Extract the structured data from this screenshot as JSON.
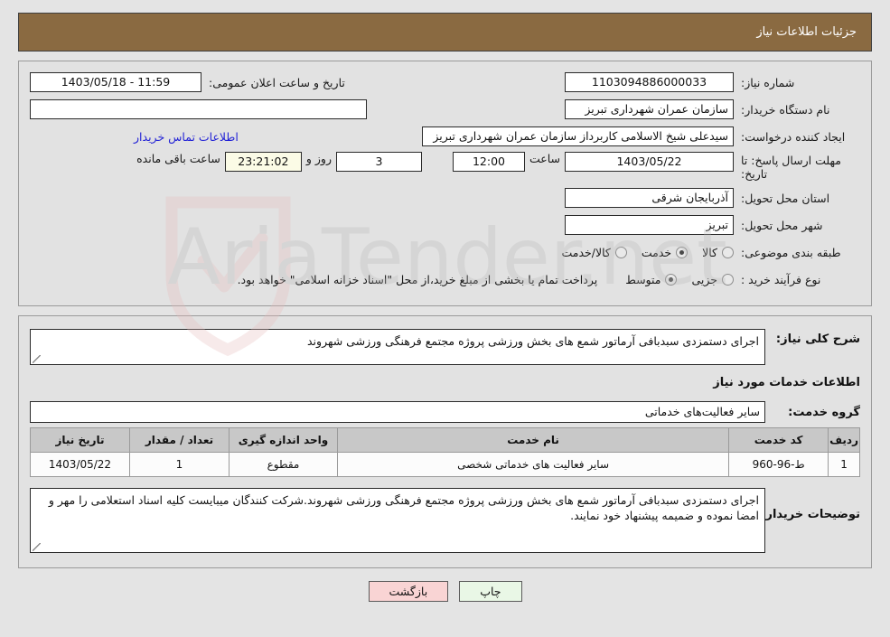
{
  "header": {
    "title": "جزئیات اطلاعات نیاز"
  },
  "form": {
    "need_number": {
      "label": "شماره نیاز:",
      "value": "1103094886000033"
    },
    "public_announce": {
      "label": "تاریخ و ساعت اعلان عمومی:",
      "value": "11:59 - 1403/05/18"
    },
    "buyer_org": {
      "label": "نام دستگاه خریدار:",
      "value": "سازمان عمران شهرداری تبریز"
    },
    "empty_field": {
      "label": "",
      "value": ""
    },
    "requester": {
      "label": "ایجاد کننده درخواست:",
      "value": "سیدعلی شیخ الاسلامی کاربرداز سازمان عمران شهرداری تبریز"
    },
    "buyer_contact_link": "اطلاعات تماس خریدار",
    "deadline": {
      "label": "مهلت ارسال پاسخ: تا تاریخ:",
      "date": "1403/05/22",
      "time_label": "ساعت",
      "time": "12:00",
      "days": "3",
      "days_label": "روز و",
      "countdown": "23:21:02",
      "countdown_label": "ساعت باقی مانده"
    },
    "province": {
      "label": "استان محل تحویل:",
      "value": "آذربایجان شرقی"
    },
    "city": {
      "label": "شهر محل تحویل:",
      "value": "تبریز"
    },
    "category": {
      "label": "طبقه بندی موضوعی:",
      "options": [
        {
          "label": "کالا",
          "selected": false
        },
        {
          "label": "خدمت",
          "selected": true
        },
        {
          "label": "کالا/خدمت",
          "selected": false
        }
      ]
    },
    "purchase_type": {
      "label": "نوع فرآیند خرید :",
      "options": [
        {
          "label": "جزیی",
          "selected": false
        },
        {
          "label": "متوسط",
          "selected": true
        }
      ],
      "note": "پرداخت تمام یا بخشی از مبلغ خرید،از محل \"اسناد خزانه اسلامی\" خواهد بود."
    }
  },
  "description": {
    "label": "شرح کلی نیاز:",
    "value": "اجرای دستمزدی سبدبافی آرماتور شمع های بخش ورزشی پروژه مجتمع فرهنگی ورزشی شهروند"
  },
  "services_section": {
    "heading": "اطلاعات خدمات مورد نیاز",
    "group_label": "گروه خدمت:",
    "group_value": "سایر فعالیت‌های خدماتی",
    "table": {
      "headers": [
        "ردیف",
        "کد خدمت",
        "نام خدمت",
        "واحد اندازه گیری",
        "تعداد / مقدار",
        "تاریخ نیاز"
      ],
      "rows": [
        [
          "1",
          "ط-96-960",
          "سایر فعالیت های خدماتی شخصی",
          "مقطوع",
          "1",
          "1403/05/22"
        ]
      ]
    }
  },
  "buyer_notes": {
    "label": "توضیحات خریدار:",
    "value": "اجرای دستمزدی سبدبافی آرماتور شمع های بخش ورزشی پروژه مجتمع فرهنگی ورزشی شهروند.شرکت کنندگان میبایست کلیه اسناد استعلامی را مهر و امضا نموده و ضمیمه پیشنهاد خود نمایند."
  },
  "buttons": {
    "print": "چاپ",
    "back": "بازگشت"
  },
  "watermark": {
    "text": "AriaTender.net"
  },
  "colors": {
    "header_bg": "#8a6a41",
    "page_bg": "#e4e4e4",
    "panel_bg": "#e2e2e2",
    "link": "#2323d6",
    "print_btn": "#e9f7e6",
    "back_btn": "#f9d4d4",
    "countdown_bg": "#fbfbe6"
  }
}
